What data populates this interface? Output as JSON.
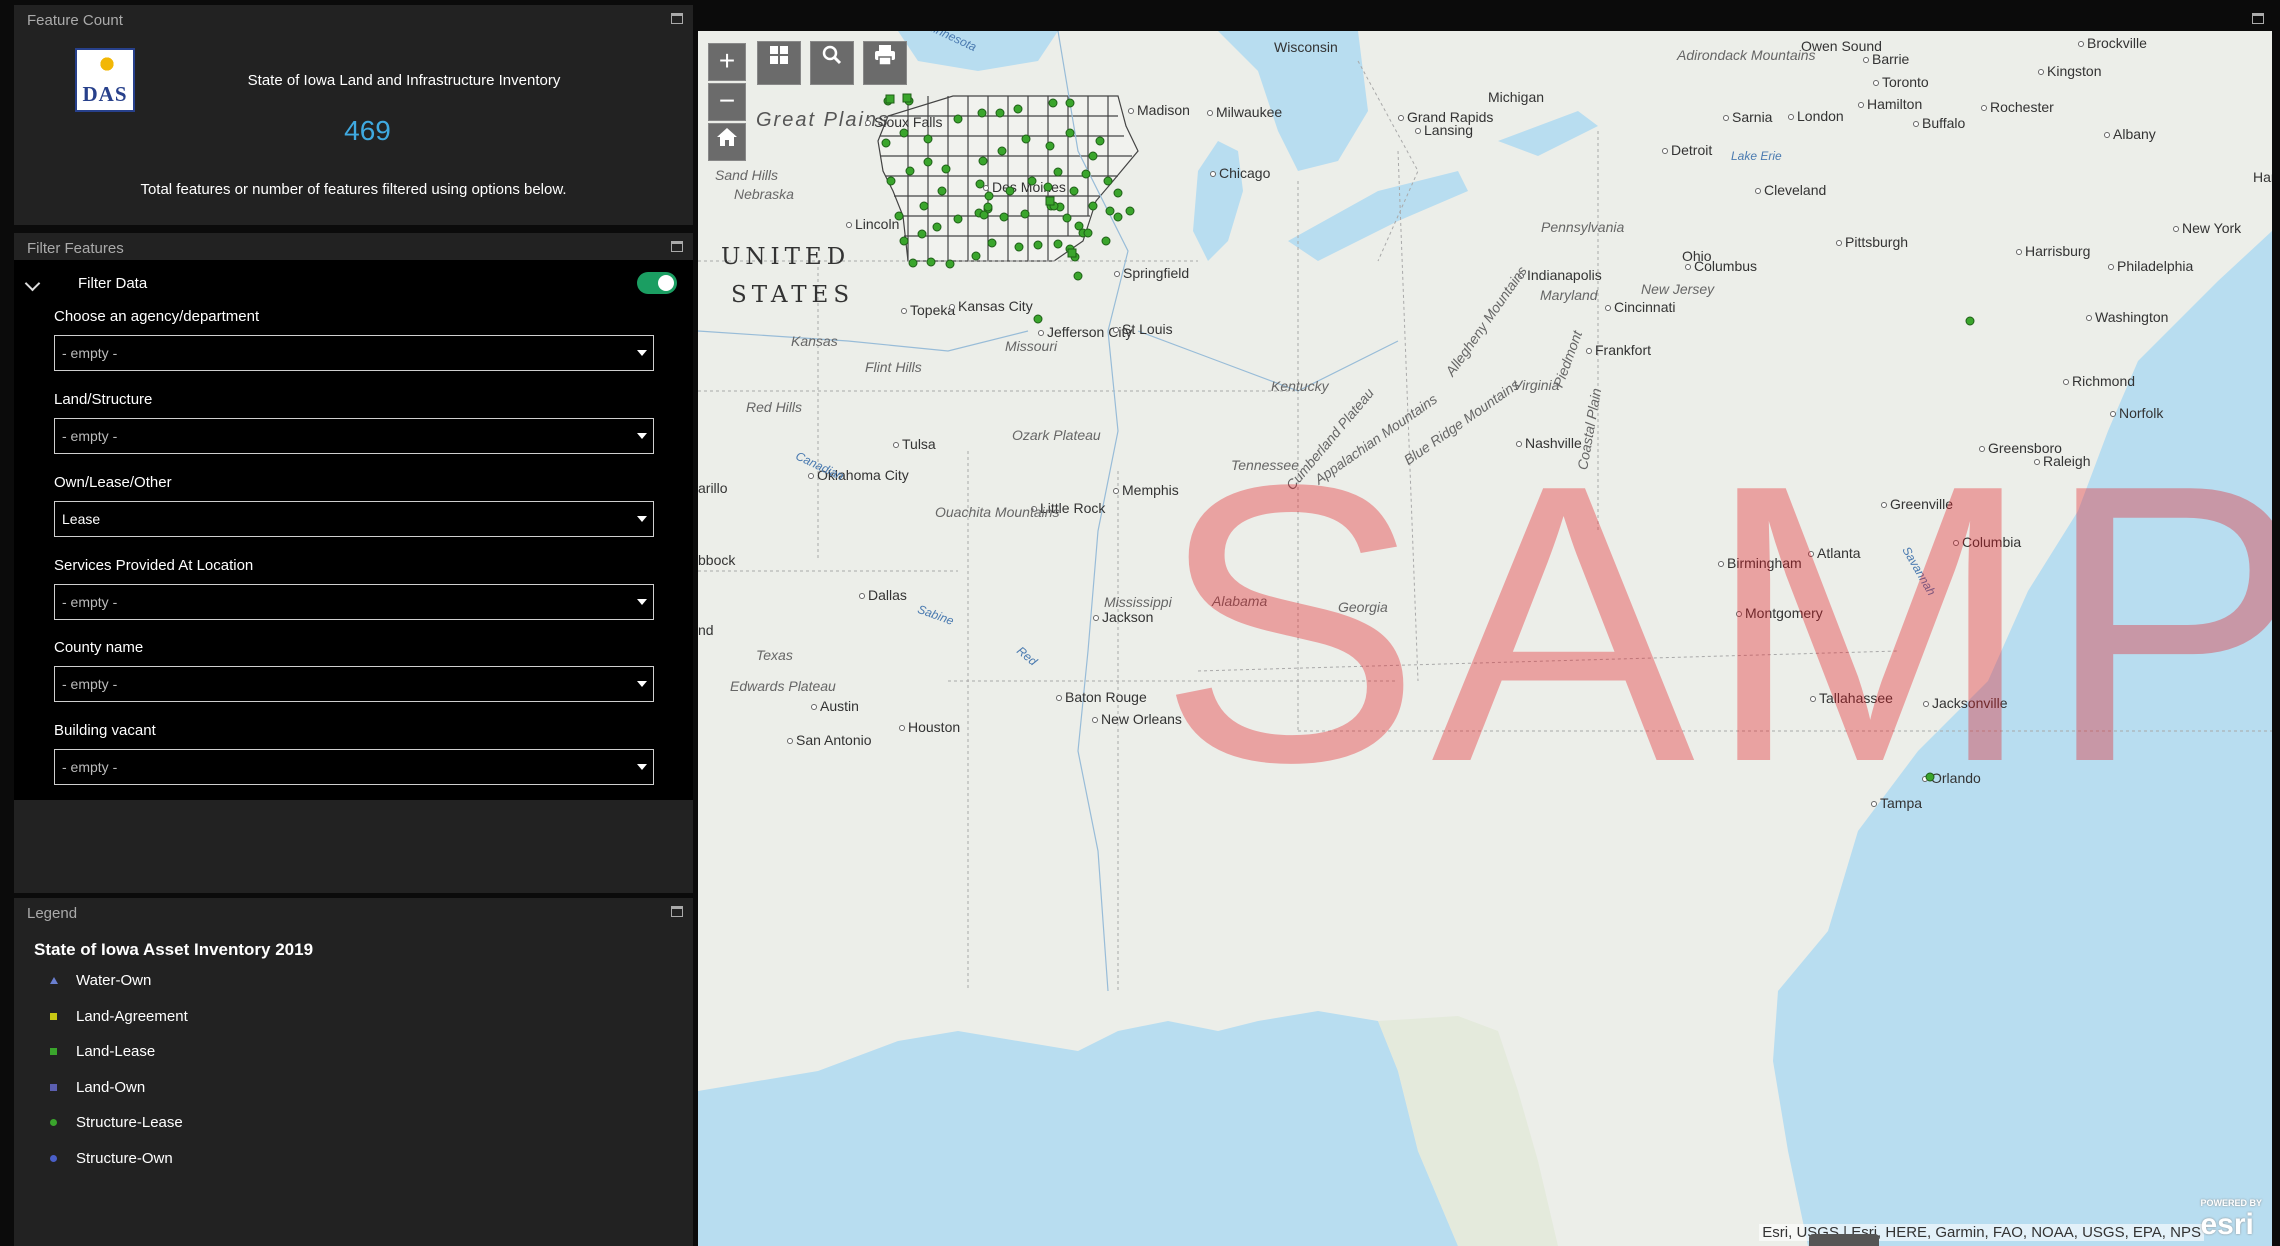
{
  "feature_count_panel": {
    "title": "Feature Count",
    "logo_text": "DAS",
    "inventory_title": "State of Iowa Land and Infrastructure Inventory",
    "count": "469",
    "description": "Total features or number of features filtered using options below."
  },
  "filter_panel": {
    "title": "Filter Features",
    "filter_data_label": "Filter Data",
    "toggle_on": true,
    "filters": [
      {
        "label": "Choose an agency/department",
        "value": "- empty -"
      },
      {
        "label": "Land/Structure",
        "value": "- empty -"
      },
      {
        "label": "Own/Lease/Other",
        "value": "Lease"
      },
      {
        "label": "Services Provided At Location",
        "value": "- empty -"
      },
      {
        "label": "County name",
        "value": "- empty -"
      },
      {
        "label": "Building vacant",
        "value": "- empty -"
      }
    ]
  },
  "legend_panel": {
    "title": "Legend",
    "layer_title": "State of Iowa Asset Inventory 2019",
    "items": [
      {
        "label": "Water-Own",
        "symbol": "triangle",
        "color": "#6a7fd0"
      },
      {
        "label": "Land-Agreement",
        "symbol": "square",
        "color": "#c8c814"
      },
      {
        "label": "Land-Lease",
        "symbol": "square",
        "color": "#3aa52c"
      },
      {
        "label": "Land-Own",
        "symbol": "square",
        "color": "#5b5fb0"
      },
      {
        "label": "Structure-Lease",
        "symbol": "circle",
        "color": "#3aa52c"
      },
      {
        "label": "Structure-Own",
        "symbol": "circle",
        "color": "#4a5fc8"
      }
    ]
  },
  "map": {
    "toolbar": {
      "zoom_in": "+",
      "zoom_out": "−",
      "basemap_icon": "basemap-gallery-icon",
      "search_icon": "search-icon",
      "print_icon": "print-icon",
      "home_icon": "home-icon"
    },
    "watermark": "SAMPLE",
    "big_labels": [
      "UNITED",
      "STATES"
    ],
    "great_plains": "Great Plains",
    "cities": [
      "Wisconsin",
      "Owen Sound",
      "Barrie",
      "Brockville",
      "Kingston",
      "Sioux Falls",
      "Madison",
      "Milwaukee",
      "Michigan",
      "Grand Rapids",
      "Lansing",
      "Toronto",
      "Hamilton",
      "Rochester",
      "Sarnia",
      "London",
      "Buffalo",
      "Albany",
      "Detroit",
      "Chicago",
      "Cleveland",
      "Des Moines",
      "Lincoln",
      "Pittsburgh",
      "Harrisburg",
      "New York",
      "Ohio",
      "Columbus",
      "Philadelphia",
      "Springfield",
      "Indianapolis",
      "Topeka",
      "Kansas City",
      "Jefferson City",
      "St Louis",
      "Cincinnati",
      "Washington",
      "Frankfort",
      "Richmond",
      "Norfolk",
      "Nashville",
      "Tulsa",
      "Oklahoma City",
      "Memphis",
      "Greensboro",
      "Raleigh",
      "Little Rock",
      "Greenville",
      "Columbia",
      "Atlanta",
      "Birmingham",
      "Dallas",
      "Jackson",
      "Montgomery",
      "Austin",
      "Houston",
      "San Antonio",
      "Baton Rouge",
      "New Orleans",
      "Tallahassee",
      "Jacksonville",
      "Orlando",
      "Tampa",
      "Hart",
      "arillo",
      "bbock",
      "nd"
    ],
    "regions": [
      "Sand Hills",
      "Nebraska",
      "Kansas",
      "Missouri",
      "Flint Hills",
      "Red Hills",
      "Ozark Plateau",
      "Kentucky",
      "Tennessee",
      "Ouachita Mountains",
      "Virginia",
      "Pennsylvania",
      "Maryland",
      "New Jersey",
      "Mississippi",
      "Alabama",
      "Georgia",
      "Texas",
      "Edwards Plateau",
      "Appalachian Mountains",
      "Adirondack Mountains",
      "Cumberland Plateau",
      "Blue Ridge Mountains",
      "Piedmont",
      "Coastal Plain",
      "Allegheny Mountains"
    ],
    "water_labels": [
      "Minnesota",
      "Lake Erie",
      "Canadian",
      "Sabine",
      "Red",
      "Savannah"
    ],
    "attribution": "Esri, USGS | Esri, HERE, Garmin, FAO, NOAA, USGS, EPA, NPS",
    "logo": "esri",
    "logo_caption": "POWERED BY"
  }
}
